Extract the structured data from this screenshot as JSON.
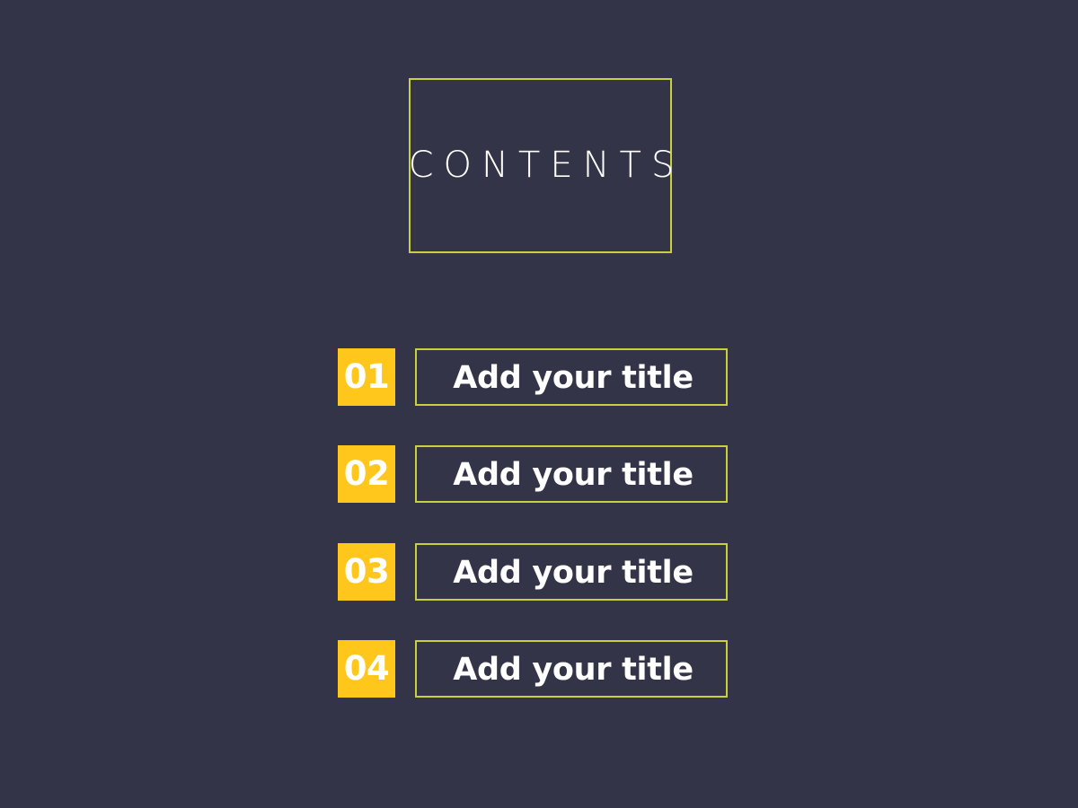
{
  "slide": {
    "background_color": "#343449",
    "accent_yellow": "#ffc61c",
    "accent_border": "#c8d13c",
    "text_color": "#ffffff"
  },
  "heading": {
    "title": "CONTENTS"
  },
  "items": [
    {
      "number": "01",
      "title": "Add your title"
    },
    {
      "number": "02",
      "title": "Add your title"
    },
    {
      "number": "03",
      "title": "Add your title"
    },
    {
      "number": "04",
      "title": "Add your title"
    }
  ]
}
